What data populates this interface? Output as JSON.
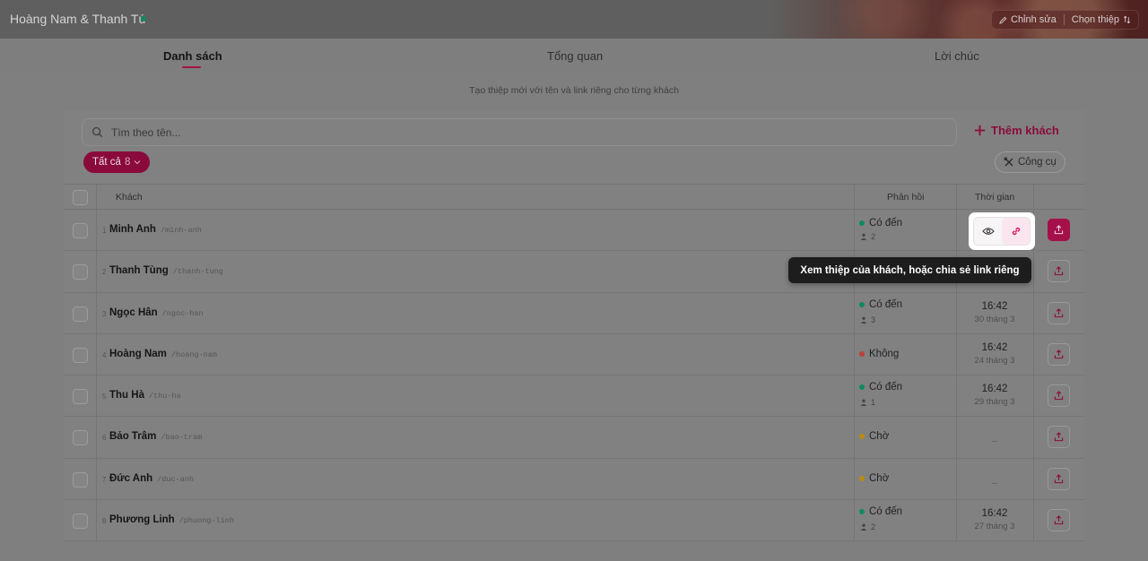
{
  "header": {
    "couple_name": "Hoàng Nam & Thanh Tú",
    "edit_label": "Chỉnh sửa",
    "choose_card_label": "Chọn thiệp"
  },
  "tabs": [
    {
      "label": "Danh sách",
      "active": true
    },
    {
      "label": "Tổng quan",
      "active": false
    },
    {
      "label": "Lời chúc",
      "active": false
    }
  ],
  "subtitle": "Tạo thiệp mới với tên và link riêng cho từng khách",
  "search": {
    "placeholder": "Tìm theo tên..."
  },
  "add_guest_label": "Thêm khách",
  "filter": {
    "label": "Tất cả",
    "count": "8"
  },
  "tools_label": "Công cụ",
  "columns": {
    "guest": "Khách",
    "response": "Phản hồi",
    "time": "Thời gian"
  },
  "tooltip": "Xem thiệp của khách, hoặc chia sẻ link riêng",
  "guests": [
    {
      "index": "1",
      "name": "Minh Anh",
      "slug": "/minh-anh",
      "status": "Có đến",
      "status_color": "#0f8a5f",
      "party": "2",
      "time": "",
      "date": ""
    },
    {
      "index": "2",
      "name": "Thanh Tùng",
      "slug": "/thanh-tung",
      "status": "",
      "status_color": "",
      "party": "",
      "time": "",
      "date": ""
    },
    {
      "index": "3",
      "name": "Ngọc Hân",
      "slug": "/ngoc-han",
      "status": "Có đến",
      "status_color": "#0f8a5f",
      "party": "3",
      "time": "16:42",
      "date": "30 tháng 3"
    },
    {
      "index": "4",
      "name": "Hoàng Nam",
      "slug": "/hoang-nam",
      "status": "Không",
      "status_color": "#b8413c",
      "party": "",
      "time": "16:42",
      "date": "24 tháng 3"
    },
    {
      "index": "5",
      "name": "Thu Hà",
      "slug": "/thu-ha",
      "status": "Có đến",
      "status_color": "#0f8a5f",
      "party": "1",
      "time": "16:42",
      "date": "29 tháng 3"
    },
    {
      "index": "6",
      "name": "Bảo Trâm",
      "slug": "/bao-tram",
      "status": "Chờ",
      "status_color": "#b88a12",
      "party": "",
      "time": "",
      "date": "",
      "dash": "–"
    },
    {
      "index": "7",
      "name": "Đức Anh",
      "slug": "/duc-anh",
      "status": "Chờ",
      "status_color": "#b88a12",
      "party": "",
      "time": "",
      "date": "",
      "dash": "–"
    },
    {
      "index": "8",
      "name": "Phương Linh",
      "slug": "/phuong-linh",
      "status": "Có đến",
      "status_color": "#0f8a5f",
      "party": "2",
      "time": "16:42",
      "date": "27 tháng 3"
    }
  ]
}
